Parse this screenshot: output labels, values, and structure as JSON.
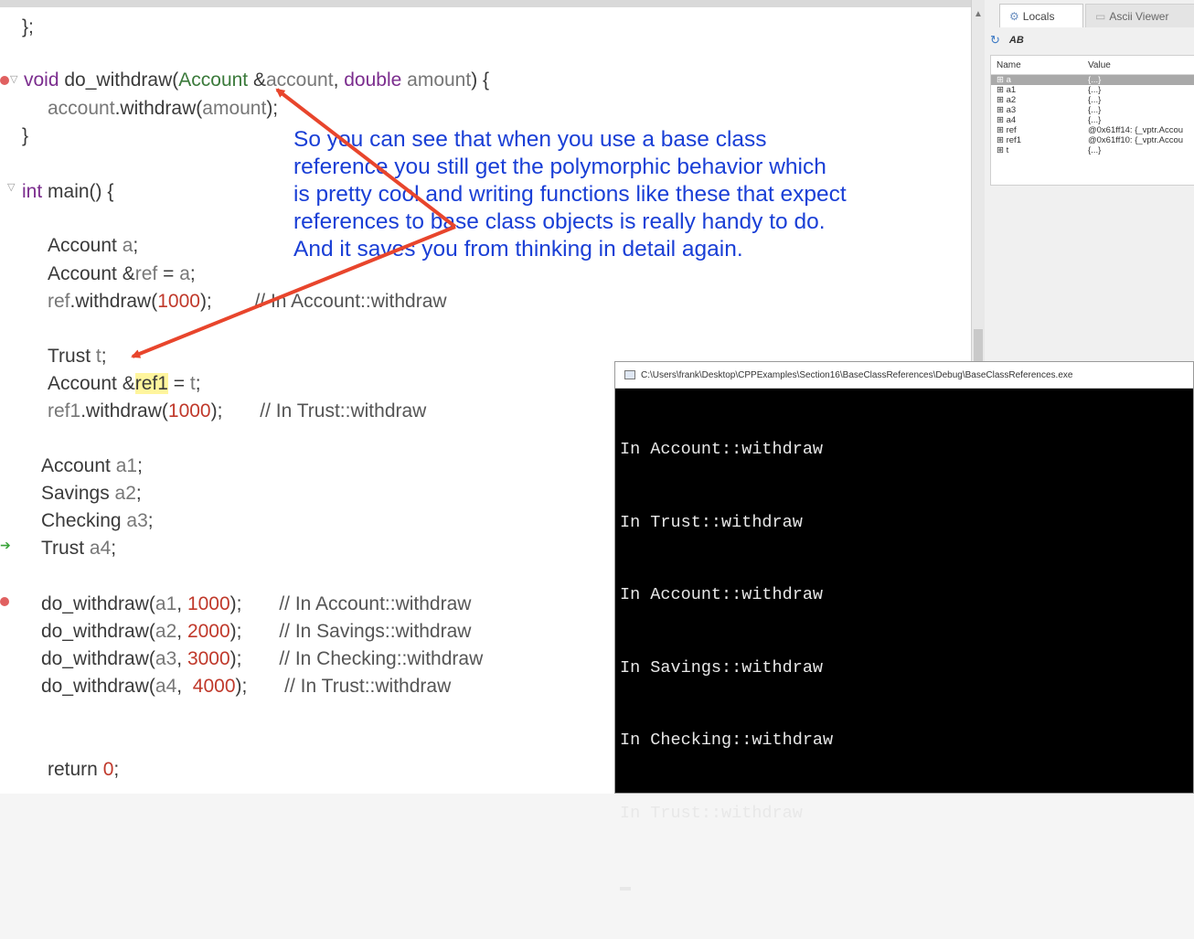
{
  "editor": {
    "lines": [
      {
        "id": "l1",
        "segs": [
          {
            "t": "};",
            "c": ""
          }
        ]
      },
      {
        "id": "l2",
        "segs": [
          {
            "t": "void ",
            "c": "kw"
          },
          {
            "t": "do_withdraw(",
            "c": ""
          },
          {
            "t": "Account",
            "c": "type"
          },
          {
            "t": " &",
            "c": ""
          },
          {
            "t": "account",
            "c": "var"
          },
          {
            "t": ", ",
            "c": ""
          },
          {
            "t": "double",
            "c": "kw"
          },
          {
            "t": " ",
            "c": ""
          },
          {
            "t": "amount",
            "c": "var"
          },
          {
            "t": ") {",
            "c": ""
          }
        ]
      },
      {
        "id": "l3",
        "segs": [
          {
            "t": "account",
            "c": "var"
          },
          {
            "t": ".withdraw(",
            "c": ""
          },
          {
            "t": "amount",
            "c": "var"
          },
          {
            "t": ");",
            "c": ""
          }
        ]
      },
      {
        "id": "l4",
        "segs": [
          {
            "t": "}",
            "c": ""
          }
        ]
      },
      {
        "id": "l5",
        "segs": [
          {
            "t": "int",
            "c": "kw"
          },
          {
            "t": " main() {",
            "c": ""
          }
        ]
      },
      {
        "id": "l6",
        "segs": [
          {
            "t": "Account ",
            "c": ""
          },
          {
            "t": "a",
            "c": "var"
          },
          {
            "t": ";",
            "c": ""
          }
        ]
      },
      {
        "id": "l7",
        "segs": [
          {
            "t": "Account &",
            "c": ""
          },
          {
            "t": "ref",
            "c": "var"
          },
          {
            "t": " = ",
            "c": ""
          },
          {
            "t": "a",
            "c": "var"
          },
          {
            "t": ";",
            "c": ""
          }
        ]
      },
      {
        "id": "l8",
        "segs": [
          {
            "t": "ref",
            "c": "var"
          },
          {
            "t": ".withdraw(",
            "c": ""
          },
          {
            "t": "1000",
            "c": "num"
          },
          {
            "t": ");        ",
            "c": ""
          },
          {
            "t": "// In Account::withdraw",
            "c": "cmt"
          }
        ]
      },
      {
        "id": "l9",
        "segs": [
          {
            "t": "Trust ",
            "c": ""
          },
          {
            "t": "t",
            "c": "var"
          },
          {
            "t": ";",
            "c": ""
          }
        ]
      },
      {
        "id": "l10",
        "segs": [
          {
            "t": "Account &",
            "c": ""
          },
          {
            "t": "ref1",
            "c": "hl"
          },
          {
            "t": " = ",
            "c": ""
          },
          {
            "t": "t",
            "c": "var"
          },
          {
            "t": ";",
            "c": ""
          }
        ]
      },
      {
        "id": "l11",
        "segs": [
          {
            "t": "ref1",
            "c": "var"
          },
          {
            "t": ".withdraw(",
            "c": ""
          },
          {
            "t": "1000",
            "c": "num"
          },
          {
            "t": ");       ",
            "c": ""
          },
          {
            "t": "// In Trust::withdraw",
            "c": "cmt"
          }
        ]
      },
      {
        "id": "l12",
        "segs": [
          {
            "t": "Account ",
            "c": ""
          },
          {
            "t": "a1",
            "c": "var"
          },
          {
            "t": ";",
            "c": ""
          }
        ]
      },
      {
        "id": "l13",
        "segs": [
          {
            "t": "Savings ",
            "c": ""
          },
          {
            "t": "a2",
            "c": "var"
          },
          {
            "t": ";",
            "c": ""
          }
        ]
      },
      {
        "id": "l14",
        "segs": [
          {
            "t": "Checking ",
            "c": ""
          },
          {
            "t": "a3",
            "c": "var"
          },
          {
            "t": ";",
            "c": ""
          }
        ]
      },
      {
        "id": "l15",
        "segs": [
          {
            "t": "Trust ",
            "c": ""
          },
          {
            "t": "a4",
            "c": "var"
          },
          {
            "t": ";",
            "c": ""
          }
        ]
      },
      {
        "id": "l16",
        "segs": [
          {
            "t": "do_withdraw(",
            "c": ""
          },
          {
            "t": "a1",
            "c": "var"
          },
          {
            "t": ", ",
            "c": ""
          },
          {
            "t": "1000",
            "c": "num"
          },
          {
            "t": ");       ",
            "c": ""
          },
          {
            "t": "// In Account::withdraw",
            "c": "cmt"
          }
        ]
      },
      {
        "id": "l17",
        "segs": [
          {
            "t": "do_withdraw(",
            "c": ""
          },
          {
            "t": "a2",
            "c": "var"
          },
          {
            "t": ", ",
            "c": ""
          },
          {
            "t": "2000",
            "c": "num"
          },
          {
            "t": ");       ",
            "c": ""
          },
          {
            "t": "// In Savings::withdraw",
            "c": "cmt"
          }
        ]
      },
      {
        "id": "l18",
        "segs": [
          {
            "t": "do_withdraw(",
            "c": ""
          },
          {
            "t": "a3",
            "c": "var"
          },
          {
            "t": ", ",
            "c": ""
          },
          {
            "t": "3000",
            "c": "num"
          },
          {
            "t": ");       ",
            "c": ""
          },
          {
            "t": "// In Checking::withdraw",
            "c": "cmt"
          }
        ]
      },
      {
        "id": "l19",
        "segs": [
          {
            "t": "do_withdraw(",
            "c": ""
          },
          {
            "t": "a4",
            "c": "var"
          },
          {
            "t": ",  ",
            "c": ""
          },
          {
            "t": "4000",
            "c": "num"
          },
          {
            "t": ");       ",
            "c": ""
          },
          {
            "t": "// In Trust::withdraw",
            "c": "cmt"
          }
        ]
      },
      {
        "id": "l20",
        "segs": [
          {
            "t": "return ",
            "c": ""
          },
          {
            "t": "0",
            "c": "num"
          },
          {
            "t": ";",
            "c": ""
          }
        ]
      }
    ],
    "syntax_colors": {
      "keyword": "#7b2d8e",
      "type": "#3b7a3b",
      "number": "#c0392b",
      "variable": "#777777",
      "comment": "#555555"
    }
  },
  "annotation": {
    "lines": [
      "So you can see that when you use a base class",
      "reference you still get the polymorphic behavior which",
      "is pretty cool and writing functions like these that expect",
      "references to base class objects is really handy to do.",
      "And it saves you from thinking in detail again."
    ],
    "color": "#1a3fd6",
    "arrow_color": "#e8452c"
  },
  "debug_panel": {
    "tabs": {
      "locals": "Locals",
      "ascii": "Ascii Viewer"
    },
    "toolbar_label": "AB",
    "columns": {
      "name": "Name",
      "value": "Value"
    },
    "rows": [
      {
        "name": "a",
        "value": "{...}",
        "selected": true
      },
      {
        "name": "a1",
        "value": "{...}"
      },
      {
        "name": "a2",
        "value": "{...}"
      },
      {
        "name": "a3",
        "value": "{...}"
      },
      {
        "name": "a4",
        "value": "{...}"
      },
      {
        "name": "ref",
        "value": "@0x61ff14: {_vptr.Accou"
      },
      {
        "name": "ref1",
        "value": "@0x61ff10: {_vptr.Accou"
      },
      {
        "name": "t",
        "value": "{...}"
      }
    ]
  },
  "console": {
    "title": "C:\\Users\\frank\\Desktop\\CPPExamples\\Section16\\BaseClassReferences\\Debug\\BaseClassReferences.exe",
    "output": [
      "In Account::withdraw",
      "In Trust::withdraw",
      "In Account::withdraw",
      "In Savings::withdraw",
      "In Checking::withdraw",
      "In Trust::withdraw"
    ]
  }
}
